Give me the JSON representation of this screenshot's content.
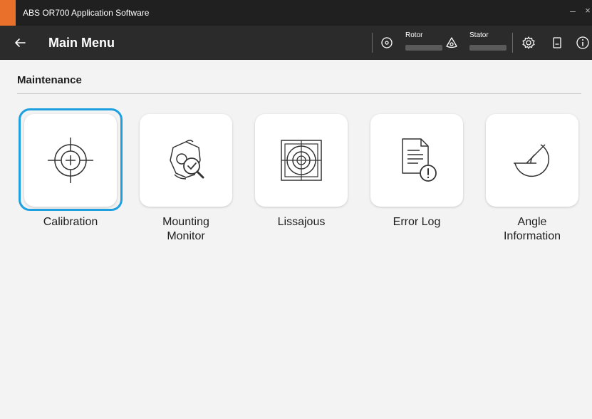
{
  "window": {
    "title": "ABS OR700 Application Software",
    "minimize_glyph": "–",
    "close_glyph": "×",
    "accent_color": "#e8702a"
  },
  "header": {
    "title": "Main Menu",
    "rotor_label": "Rotor",
    "stator_label": "Stator",
    "icons": [
      "back-arrow-icon",
      "rotor-icon",
      "stator-icon",
      "settings-icon",
      "manual-icon",
      "info-icon"
    ]
  },
  "section": {
    "title": "Maintenance"
  },
  "tiles": [
    {
      "label": "Calibration",
      "icon": "crosshair-icon"
    },
    {
      "label": "Mounting\nMonitor",
      "icon": "mounting-monitor-icon"
    },
    {
      "label": "Lissajous",
      "icon": "lissajous-icon"
    },
    {
      "label": "Error Log",
      "icon": "error-log-icon"
    },
    {
      "label": "Angle\nInformation",
      "icon": "angle-icon"
    }
  ],
  "colors": {
    "focus": "#1ea0e0",
    "header_bg": "#2b2b2b",
    "titlebar_bg": "#202020"
  }
}
